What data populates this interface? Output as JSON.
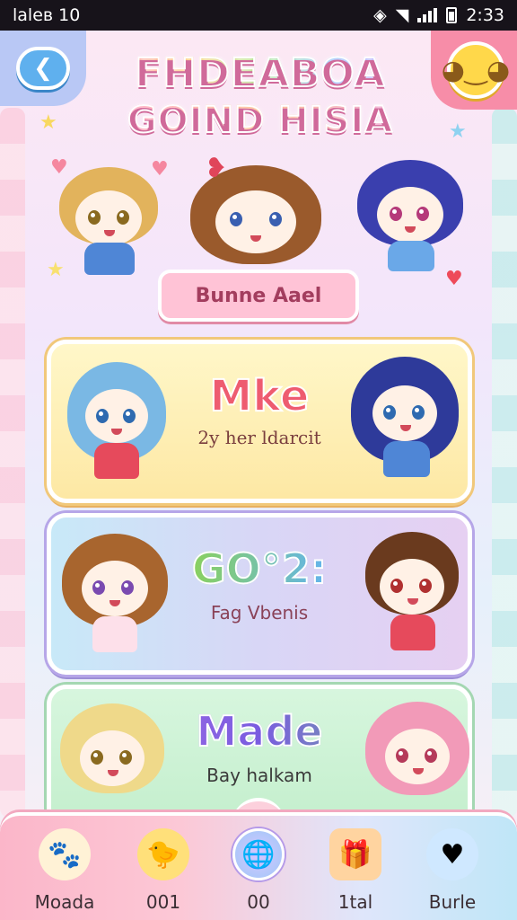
{
  "status_bar": {
    "left_text": "laleв 10",
    "time": "2:33"
  },
  "header": {
    "title_line1": "FHDEABOA",
    "title_line2": "GOIND HISIA",
    "back_icon": "back-arrow-icon",
    "menu_icon": "smiley-icon"
  },
  "choose_banner": {
    "label": "Bunne Aael"
  },
  "cards": [
    {
      "title": "Mke",
      "subtitle": "2y her ldarcit"
    },
    {
      "title": "GO°2:",
      "subtitle": "Fag Vbenis"
    },
    {
      "title": "Made",
      "subtitle": "Bay halkam"
    }
  ],
  "bottom_nav": {
    "items": [
      {
        "label": "Moada",
        "icon": "creature-icon"
      },
      {
        "label": "001",
        "icon": "chick-icon"
      },
      {
        "label": "00",
        "icon": "globe-icon",
        "active": true
      },
      {
        "label": "1tal",
        "icon": "gift-card-icon"
      },
      {
        "label": "Burle",
        "icon": "heart-balloon-icon"
      }
    ]
  },
  "colors": {
    "accent_pink": "#f78da8",
    "accent_blue": "#5fb0ee",
    "accent_yellow": "#ffd84a"
  }
}
